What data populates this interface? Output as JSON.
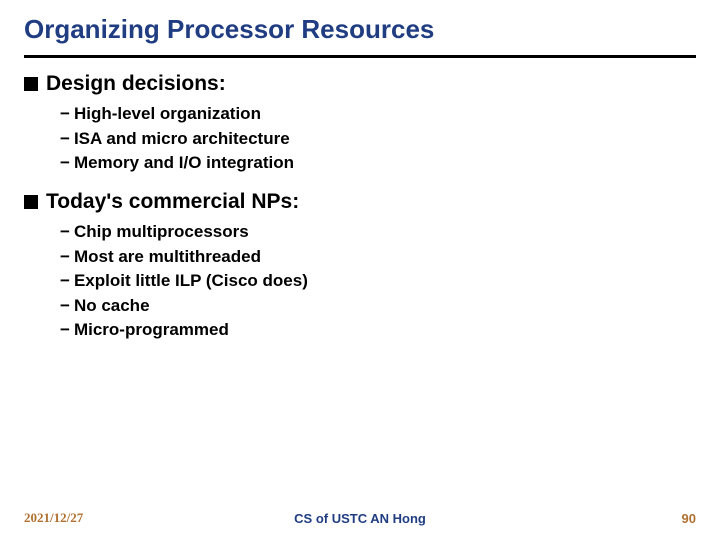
{
  "title": "Organizing Processor Resources",
  "sections": [
    {
      "heading": "Design decisions:",
      "items": [
        "High-level organization",
        "ISA and micro architecture",
        "Memory and I/O integration"
      ]
    },
    {
      "heading": "Today's commercial NPs:",
      "items": [
        "Chip multiprocessors",
        "Most are multithreaded",
        "Exploit little ILP (Cisco does)",
        "No cache",
        "Micro-programmed"
      ]
    }
  ],
  "footer": {
    "date": "2021/12/27",
    "center": "CS of USTC AN Hong",
    "page": "90"
  }
}
